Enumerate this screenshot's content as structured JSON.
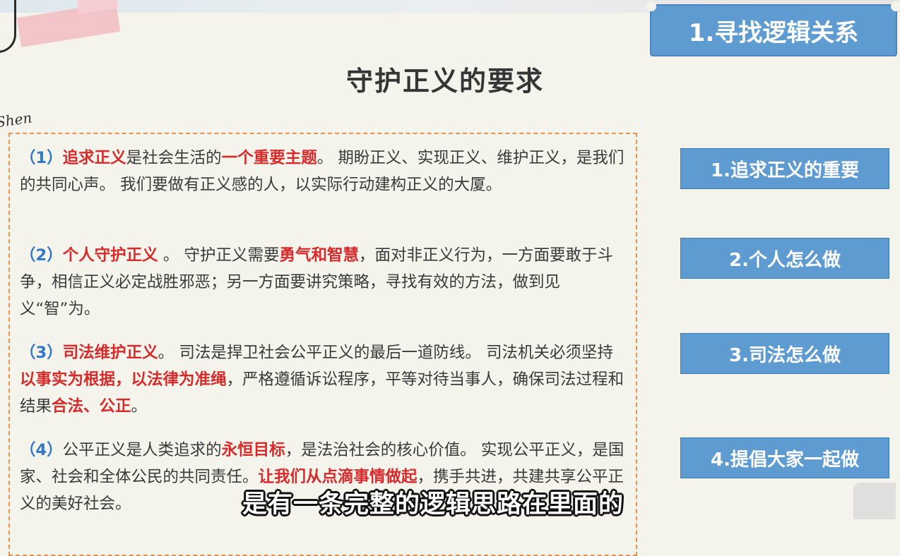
{
  "watermark_text": "Shen",
  "page_title": "守护正义的要求",
  "header_label": "1.寻找逻辑关系",
  "side_buttons": [
    "1.追求正义的重要",
    "2.个人怎么做",
    "3.司法怎么做",
    "4.提倡大家一起做"
  ],
  "paragraphs": [
    {
      "num": "（1）",
      "segments": [
        {
          "t": "追求正义",
          "hl": true
        },
        {
          "t": "是社会生活的",
          "hl": false
        },
        {
          "t": "一个重要主题",
          "hl": true
        },
        {
          "t": "。 期盼正义、实现正义、维护正义，是我们的共同心声。 我们要做有正义感的人，以实际行动建构正义的大厦。",
          "hl": false
        }
      ]
    },
    {
      "num": "（2）",
      "segments": [
        {
          "t": "个人守护正义",
          "hl": true
        },
        {
          "t": " 。 守护正义需要",
          "hl": false
        },
        {
          "t": "勇气和智慧",
          "hl": true
        },
        {
          "t": "，面对非正义行为，一方面要敢于斗争，相信正义必定战胜邪恶；另一方面要讲究策略，寻找有效的方法，做到见义“智”为。",
          "hl": false
        }
      ]
    },
    {
      "num": "（3）",
      "segments": [
        {
          "t": "司法维护正义",
          "hl": true
        },
        {
          "t": "。 司法是捍卫社会公平正义的最后一道防线。 司法机关必须坚持",
          "hl": false
        },
        {
          "t": "以事实为根据，以法律为准绳",
          "hl": true
        },
        {
          "t": "，严格遵循诉讼程序，平等对待当事人，确保司法过程和结果",
          "hl": false
        },
        {
          "t": "合法、公正",
          "hl": true
        },
        {
          "t": "。",
          "hl": false
        }
      ]
    },
    {
      "num": "（4）",
      "segments": [
        {
          "t": "公平正义是人类追求的",
          "hl": false
        },
        {
          "t": "永恒目标",
          "hl": true
        },
        {
          "t": "，是法治社会的核心价值。 实现公平正义，是国家、社会和全体公民的共同责任。",
          "hl": false
        },
        {
          "t": "让我们从点滴事情做起",
          "hl": true
        },
        {
          "t": "，携手共进，共建共享公平正义的美好社会。",
          "hl": false
        }
      ]
    }
  ],
  "subtitle": "是有一条完整的逻辑思路在里面的"
}
